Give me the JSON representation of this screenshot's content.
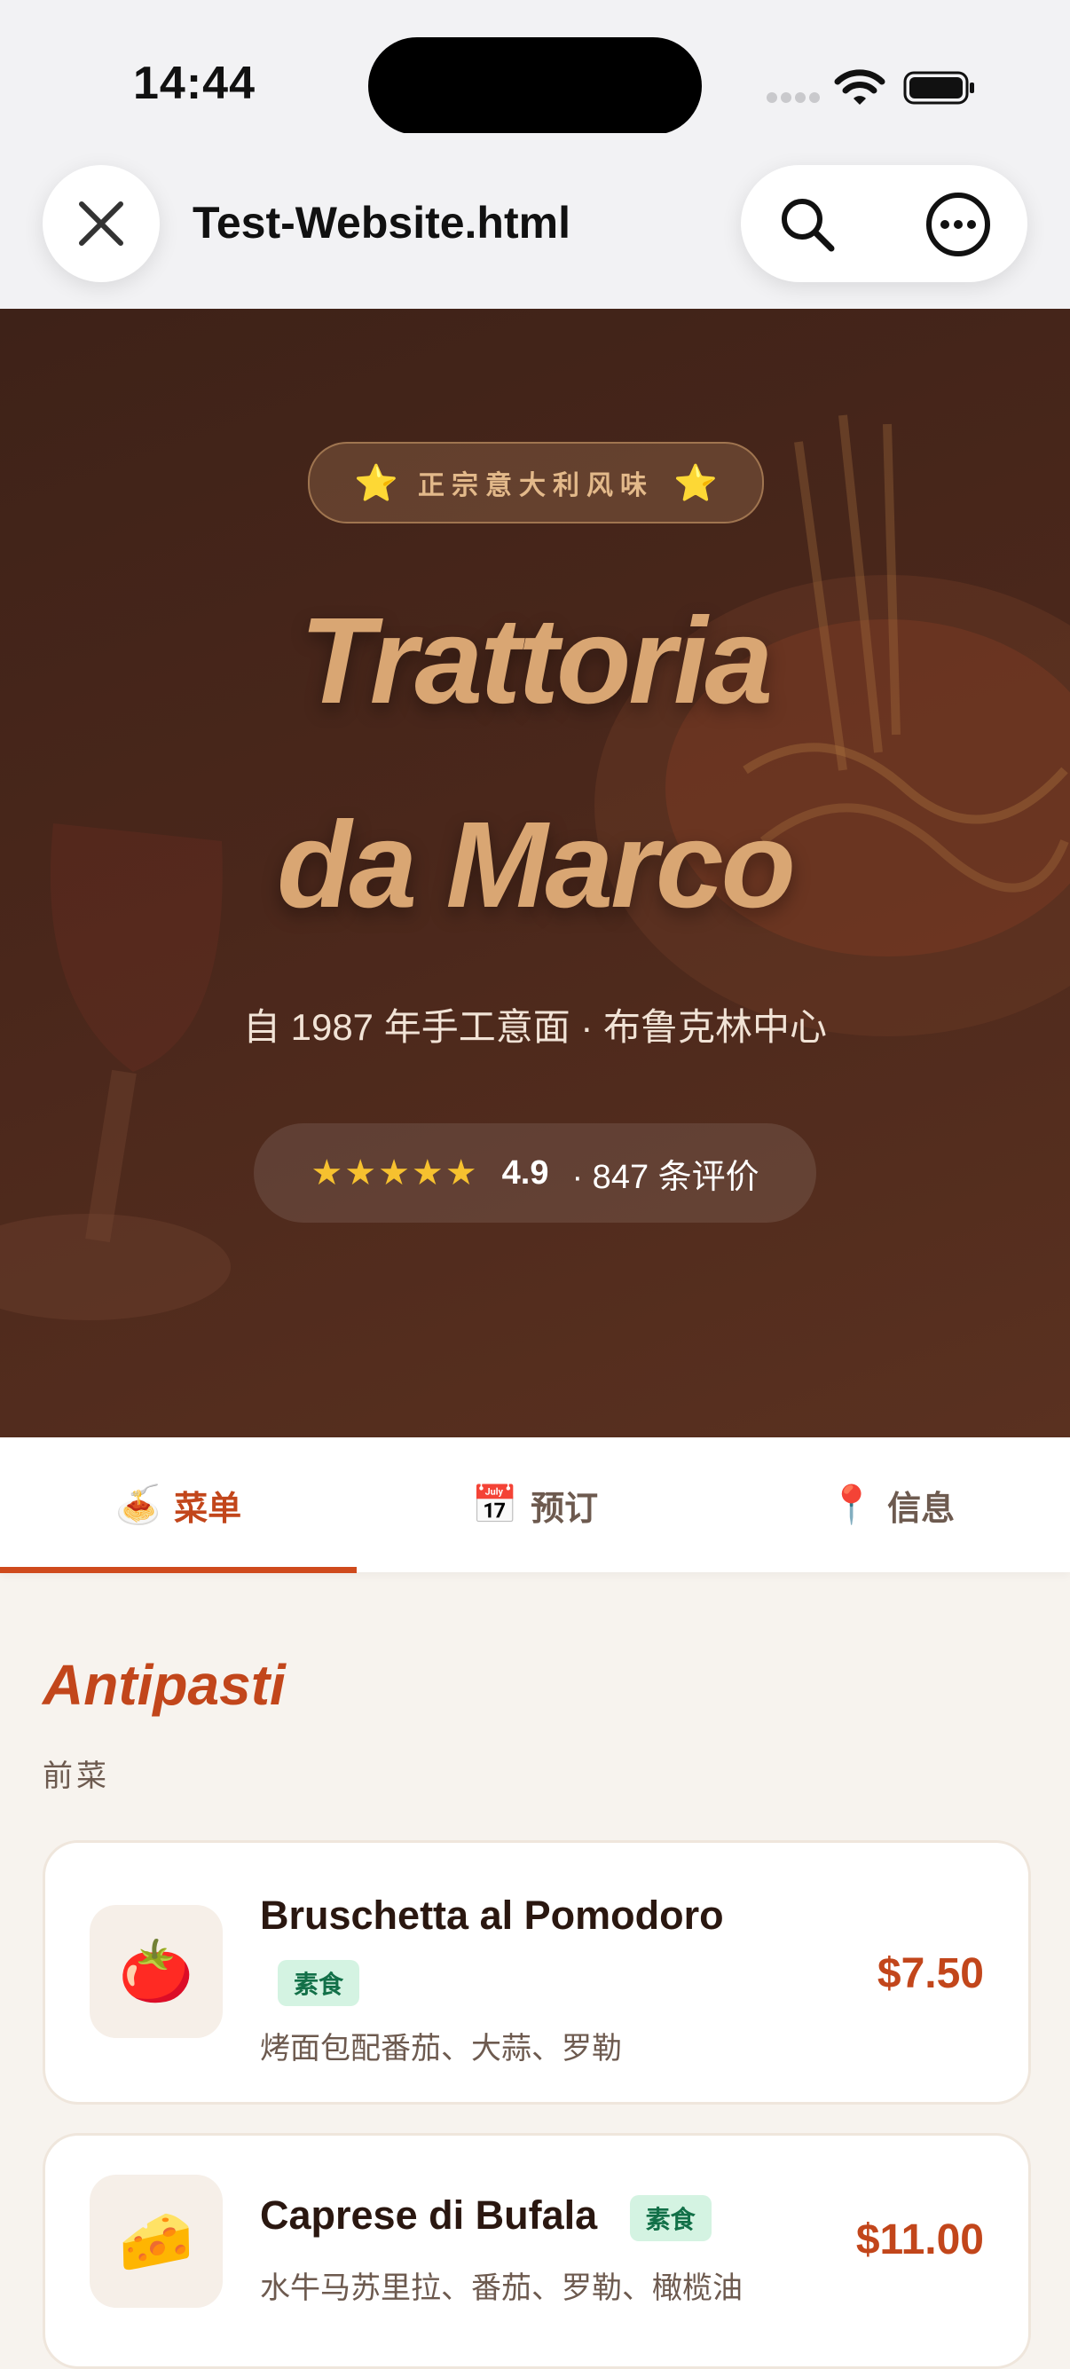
{
  "status": {
    "time": "14:44"
  },
  "browser": {
    "page_title": "Test-Website.html"
  },
  "hero": {
    "badge": "正宗意大利风味",
    "title_line1": "Trattoria",
    "title_line2": "da Marco",
    "subtitle": "自 1987 年手工意面 · 布鲁克林中心",
    "stars": "★★★★★",
    "score": "4.9",
    "reviews": "· 847 条评价"
  },
  "tabs": [
    {
      "icon": "🍝",
      "label": "菜单",
      "active": true
    },
    {
      "icon": "📅",
      "label": "预订",
      "active": false
    },
    {
      "icon": "📍",
      "label": "信息",
      "active": false
    }
  ],
  "menu": {
    "section_title": "Antipasti",
    "section_sub": "前菜",
    "items": [
      {
        "emoji": "🍅",
        "name": "Bruschetta al Pomodoro",
        "tag": "素食",
        "desc": "烤面包配番茄、大蒜、罗勒",
        "price": "$7.50"
      },
      {
        "emoji": "🧀",
        "name": "Caprese di Bufala",
        "tag": "素食",
        "desc": "水牛马苏里拉、番茄、罗勒、橄榄油",
        "price": "$11.00"
      }
    ]
  },
  "colors": {
    "accent": "#c2461b",
    "hero_bg": "#4a271b",
    "hero_title": "#d9a673",
    "star": "#f6c12f",
    "veg_bg": "#d4f3e2",
    "veg_text": "#127048"
  }
}
